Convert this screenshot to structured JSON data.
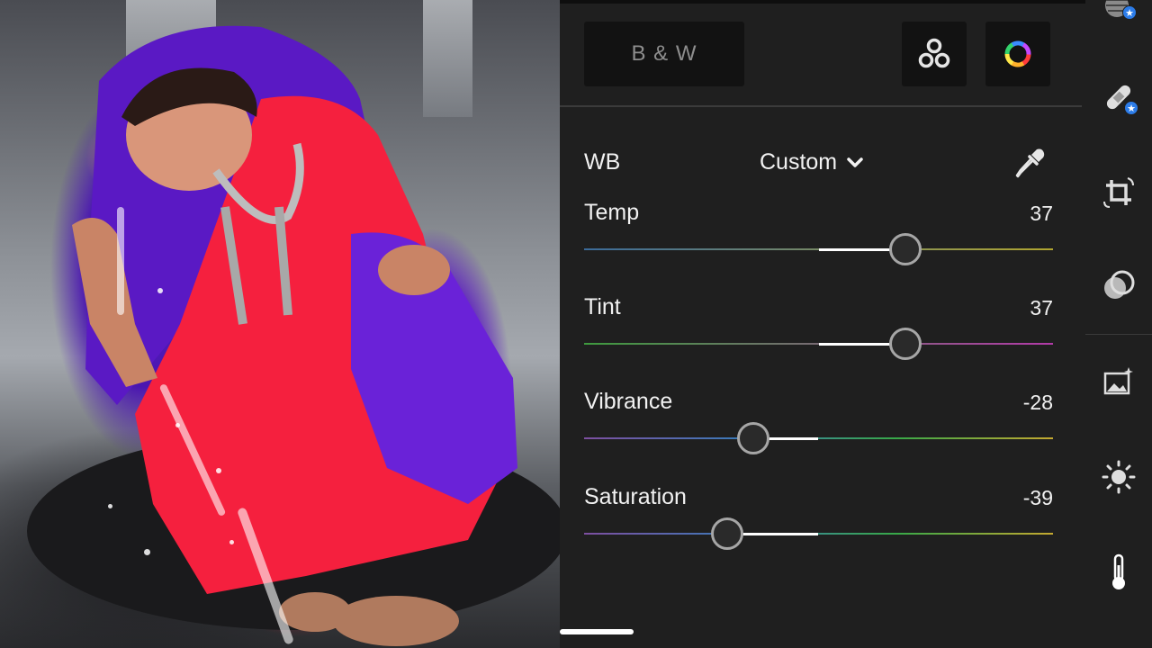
{
  "panel": {
    "bw_label": "B & W",
    "profiles_icon": "circles-profile-icon",
    "color_icon": "color-wheel-icon",
    "wb_label": "WB",
    "wb_preset": "Custom",
    "eyedropper_icon": "eyedropper-icon",
    "adjustments": [
      {
        "label": "Temp",
        "value": "37",
        "level": 37,
        "range": [
          -100,
          100
        ],
        "gradient": [
          "#3b6b9a",
          "#b0a530"
        ]
      },
      {
        "label": "Tint",
        "value": "37",
        "level": 37,
        "range": [
          -100,
          100
        ],
        "gradient": [
          "#3e9a3e",
          "#b23aa8"
        ]
      },
      {
        "label": "Vibrance",
        "value": "-28",
        "level": -28,
        "range": [
          -100,
          100
        ],
        "gradient": [
          "#7d4fa0",
          "#3a7ab8",
          "#38a848",
          "#c4a830"
        ]
      },
      {
        "label": "Saturation",
        "value": "-39",
        "level": -39,
        "range": [
          -100,
          100
        ],
        "gradient": [
          "#7d4fa0",
          "#3a7ab8",
          "#38a848",
          "#c4a830"
        ]
      }
    ]
  },
  "rail": {
    "tools": [
      {
        "name": "selective-mask-icon",
        "badge": true
      },
      {
        "name": "healing-bandage-icon",
        "badge": true
      },
      {
        "name": "crop-rotate-icon",
        "badge": false
      },
      {
        "name": "masking-icon",
        "badge": false
      },
      {
        "name": "presets-image-icon",
        "badge": false
      },
      {
        "name": "light-sun-icon",
        "badge": false
      },
      {
        "name": "color-thermometer-icon",
        "badge": false,
        "active": true
      }
    ]
  },
  "colors": {
    "panel_bg": "#1f1f1f",
    "button_bg": "#121212",
    "text": "#f2f2f2",
    "muted_text": "#8d8d8d",
    "badge_blue": "#2c7ce8"
  }
}
